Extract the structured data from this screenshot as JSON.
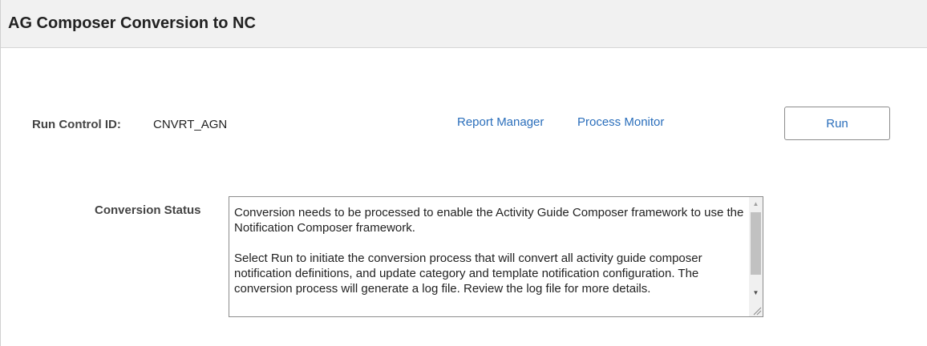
{
  "header": {
    "title": "AG Composer Conversion to NC"
  },
  "run_control": {
    "label": "Run Control ID:",
    "value": "CNVRT_AGN"
  },
  "links": {
    "report_manager": "Report Manager",
    "process_monitor": "Process Monitor"
  },
  "run_button": {
    "label": "Run"
  },
  "conversion_status": {
    "label": "Conversion Status",
    "paragraph_1": "Conversion needs to be processed to enable the Activity Guide Composer framework to use the Notification Composer framework.",
    "paragraph_2": "Select Run to initiate the conversion process that will convert all activity guide composer notification definitions, and update category and template notification configuration.  The conversion process will generate a log file.  Review the log file for more details."
  },
  "colors": {
    "link": "#2a6ebb",
    "header_bg": "#f1f1f1",
    "border": "#8c8c8c"
  }
}
